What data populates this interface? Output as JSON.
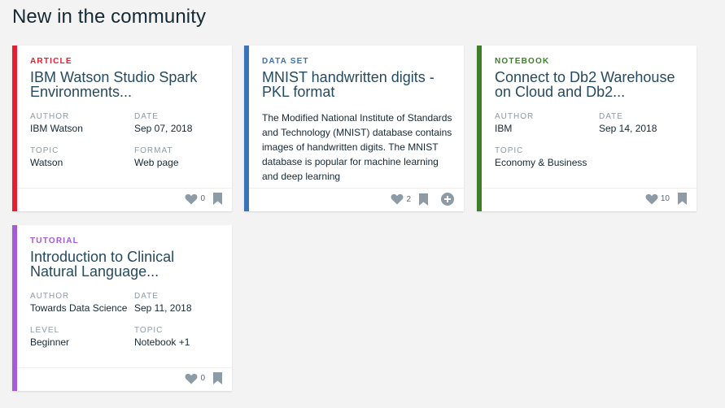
{
  "page": {
    "heading": "New in the community"
  },
  "colors": {
    "article": "#e71d32",
    "dataset": "#3b73b9",
    "notebook": "#3d7e27",
    "tutorial": "#a45ad9",
    "icon": "#8c9ba5"
  },
  "cards": [
    {
      "tag": "ARTICLE",
      "title": "IBM Watson Studio Spark Environments...",
      "meta": [
        {
          "label": "AUTHOR",
          "value": "IBM Watson"
        },
        {
          "label": "DATE",
          "value": "Sep 07, 2018"
        },
        {
          "label": "TOPIC",
          "value": "Watson"
        },
        {
          "label": "FORMAT",
          "value": "Web page"
        }
      ],
      "likes": "0"
    },
    {
      "tag": "DATA SET",
      "title": "MNIST handwritten digits - PKL format",
      "description": "The Modified National Institute of Standards and Technology (MNIST) database contains images of handwritten digits. The MNIST database is popular for machine learning and deep learning",
      "likes": "2"
    },
    {
      "tag": "NOTEBOOK",
      "title": "Connect to Db2 Warehouse on Cloud and Db2...",
      "meta": [
        {
          "label": "AUTHOR",
          "value": "IBM"
        },
        {
          "label": "DATE",
          "value": "Sep 14, 2018"
        },
        {
          "label": "TOPIC",
          "value": "Economy & Business"
        }
      ],
      "likes": "10"
    },
    {
      "tag": "TUTORIAL",
      "title": "Introduction to Clinical Natural Language...",
      "meta": [
        {
          "label": "AUTHOR",
          "value": "Towards Data Science"
        },
        {
          "label": "DATE",
          "value": "Sep 11, 2018"
        },
        {
          "label": "LEVEL",
          "value": "Beginner"
        },
        {
          "label": "TOPIC",
          "value": "Notebook +1"
        }
      ],
      "likes": "0"
    }
  ]
}
